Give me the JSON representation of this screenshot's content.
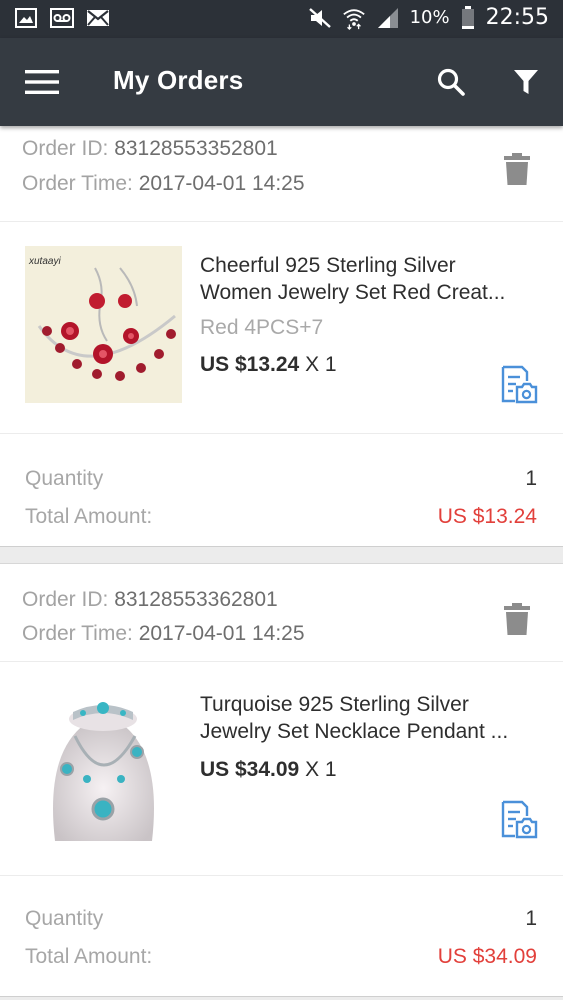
{
  "status_bar": {
    "battery": "10%",
    "time": "22:55",
    "icons": [
      "image-icon",
      "voicemail-icon",
      "mail-icon",
      "mute-icon",
      "wifi-icon",
      "signal-icon",
      "battery-icon"
    ]
  },
  "app_bar": {
    "title": "My Orders",
    "icons": [
      "menu-icon",
      "search-icon",
      "filter-icon"
    ]
  },
  "colors": {
    "app_bar": "#353b42",
    "status_bar": "#2c3138",
    "total_amount": "#e2403b",
    "action_icon": "#4a90d9"
  },
  "orders": [
    {
      "id_label": "Order ID:",
      "id": "83128553352801",
      "time_label": "Order Time:",
      "time": "2017-04-01 14:25",
      "product": {
        "title_line1": " Cheerful 925 Sterling Silver",
        "title_line2": "Women Jewelry Set Red Creat...",
        "variant": "Red 4PCS+7",
        "price": "US $13.24",
        "qty_suffix": "X 1",
        "image_brand": "xutaayi"
      },
      "quantity_label": "Quantity",
      "quantity": "1",
      "total_label": "Total Amount:",
      "total": "US $13.24"
    },
    {
      "id_label": "Order ID:",
      "id": "83128553362801",
      "time_label": "Order Time:",
      "time": "2017-04-01 14:25",
      "product": {
        "title_line1": "Turquoise 925 Sterling Silver",
        "title_line2": "Jewelry Set Necklace Pendant ...",
        "price": "US $34.09",
        "qty_suffix": "X 1"
      },
      "quantity_label": "Quantity",
      "quantity": "1",
      "total_label": "Total Amount:",
      "total": "US $34.09"
    }
  ]
}
